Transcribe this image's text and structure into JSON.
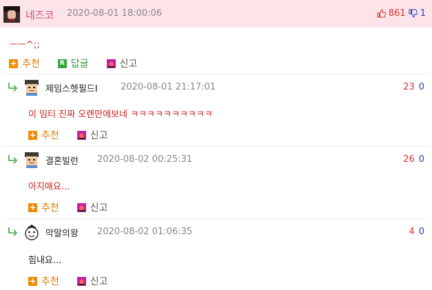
{
  "top_comment": {
    "nickname": "네즈코",
    "timestamp": "2020-08-01 18:00:06",
    "upvotes": "861",
    "downvotes": "1",
    "body": "ㅡㅡ^;;",
    "actions": {
      "recommend": "추천",
      "reply": "답글",
      "report": "신고"
    }
  },
  "replies": [
    {
      "nickname": "제임스헷필드I",
      "timestamp": "2020-08-01 21:17:01",
      "upvotes": "23",
      "downvotes": "0",
      "body": "이 임티 진짜 오랜만에보네 ㅋㅋㅋㅋㅋㅋㅋㅋㅋㅋ",
      "body_color": "red",
      "avatar_icon": "pixel-guy-icon"
    },
    {
      "nickname": "결혼빌런",
      "timestamp": "2020-08-02 00:25:31",
      "upvotes": "26",
      "downvotes": "0",
      "body": "아지매요...",
      "body_color": "red",
      "avatar_icon": "pixel-guy-icon"
    },
    {
      "nickname": "막말의왕",
      "timestamp": "2020-08-02 01:06:35",
      "upvotes": "4",
      "downvotes": "0",
      "body": "힘내요...",
      "body_color": "dark",
      "avatar_icon": "cartoon-face-icon"
    }
  ],
  "reply_actions": {
    "recommend": "추천",
    "report": "신고"
  },
  "colors": {
    "header_bg": "#fce4e8",
    "nickname_pink": "#d4498a",
    "upvote_red": "#e03030",
    "downvote_blue": "#2040c0",
    "recommend_orange": "#f08a00",
    "reply_green": "#3aa640"
  }
}
